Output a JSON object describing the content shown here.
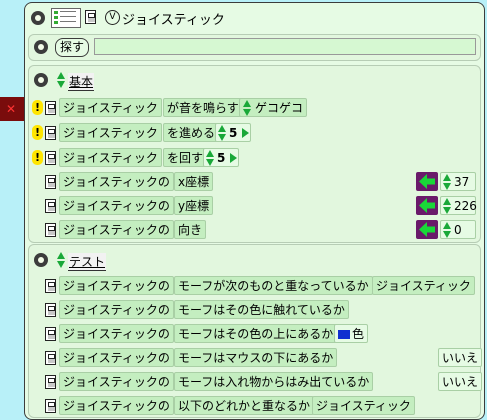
{
  "window": {
    "title": "ジョイスティック",
    "menu_v": "V"
  },
  "search": {
    "button": "探す",
    "value": ""
  },
  "category_basic": {
    "label": "基本",
    "rows": [
      {
        "kind": "command",
        "subject": "ジョイスティック",
        "verb": "が音を鳴らす",
        "param": "ゲコゲコ"
      },
      {
        "kind": "command",
        "subject": "ジョイスティック",
        "verb": "を進める",
        "param": "5"
      },
      {
        "kind": "command",
        "subject": "ジョイスティック",
        "verb": "を回す",
        "param": "5"
      },
      {
        "kind": "getter",
        "subject": "ジョイスティックの",
        "prop": "x座標",
        "value": "37"
      },
      {
        "kind": "getter",
        "subject": "ジョイスティックの",
        "prop": "y座標",
        "value": "226"
      },
      {
        "kind": "getter",
        "subject": "ジョイスティックの",
        "prop": "向き",
        "value": "0"
      }
    ]
  },
  "category_test": {
    "label": "テスト",
    "rows": [
      {
        "subject": "ジョイスティックの",
        "prop": "モーフが次のものと重なっているか",
        "arg": "ジョイスティック",
        "value": ""
      },
      {
        "subject": "ジョイスティックの",
        "prop": "モーフはその色に触れているか",
        "arg": "",
        "value": ""
      },
      {
        "subject": "ジョイスティックの",
        "prop": "モーフはその色の上にあるか",
        "arg": "色",
        "value": ""
      },
      {
        "subject": "ジョイスティックの",
        "prop": "モーフはマウスの下にあるか",
        "arg": "",
        "value": "いいえ"
      },
      {
        "subject": "ジョイスティックの",
        "prop": "モーフは入れ物からはみ出ているか",
        "arg": "",
        "value": "いいえ"
      },
      {
        "subject": "ジョイスティックの",
        "prop": "以下のどれかと重なるか",
        "arg": "ジョイスティック",
        "value": ""
      }
    ]
  },
  "colors": {
    "desktop": "#b8f0f8",
    "viewer_bg": "#e6fbe4",
    "tile": "#c4eec0",
    "arrow_tile": "#6a1a6a",
    "arrow_green": "#19d838",
    "swatch": "#1030d0",
    "bang": "#ffe500"
  }
}
